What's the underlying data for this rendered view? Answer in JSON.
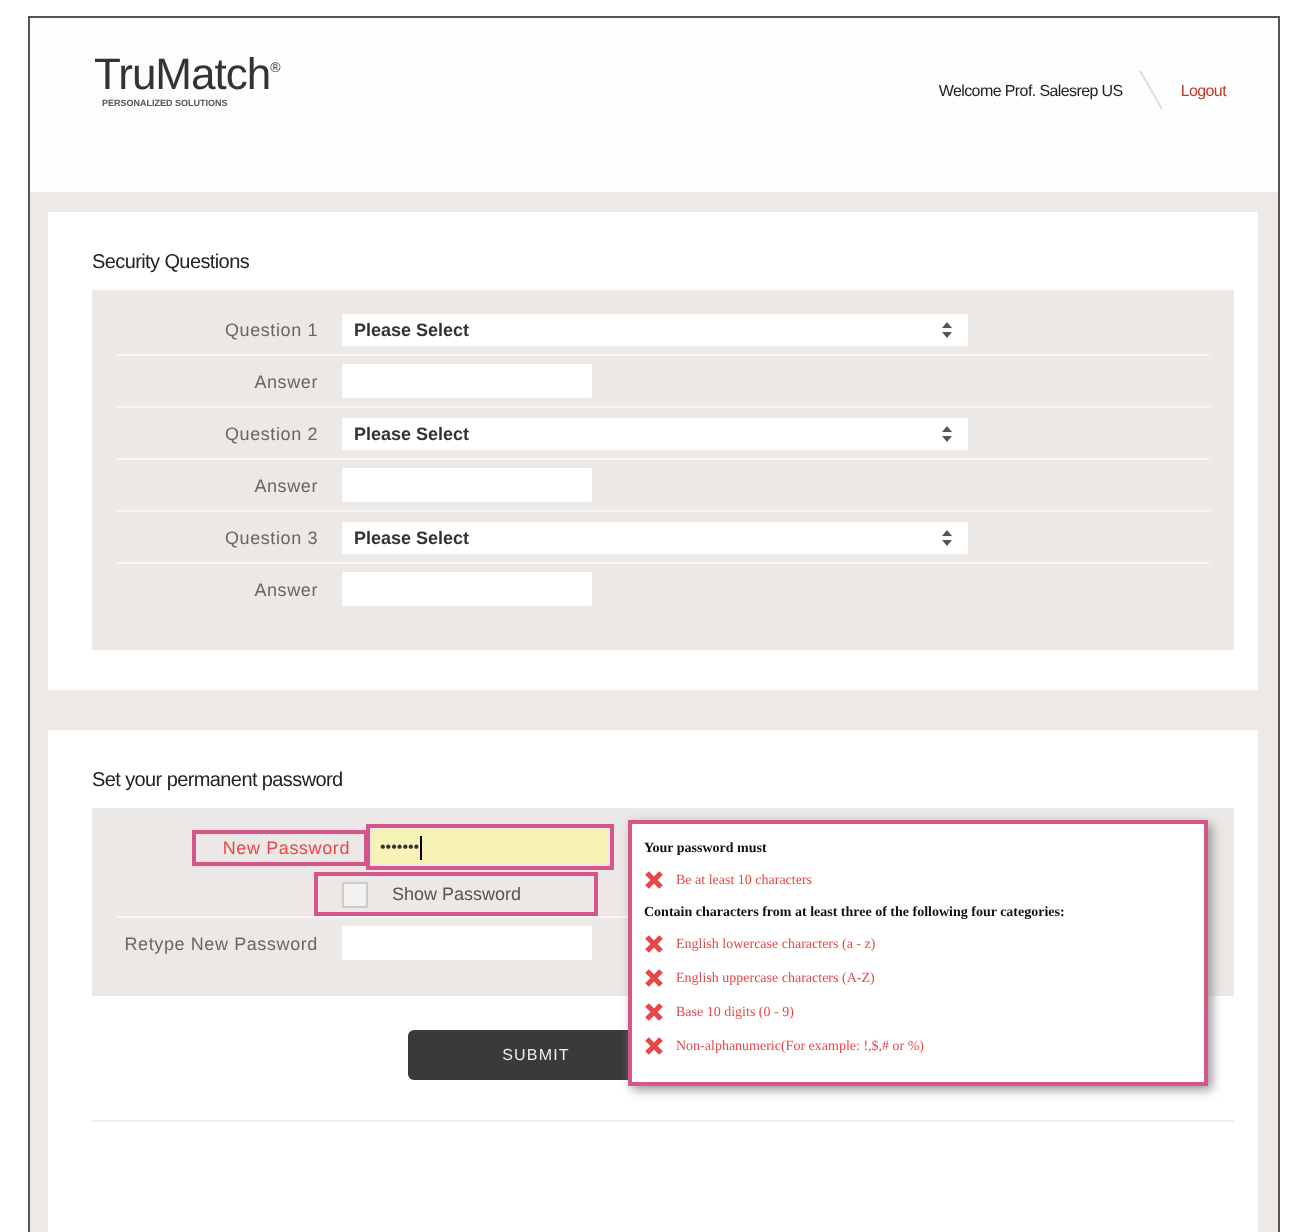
{
  "header": {
    "logo": "TruMatch",
    "logo_mark": "®",
    "tagline": "PERSONALIZED SOLUTIONS",
    "welcome": "Welcome Prof. Salesrep US",
    "logout": "Logout"
  },
  "security": {
    "title": "Security Questions",
    "rows": [
      {
        "kind": "select",
        "label": "Question 1",
        "value": "Please Select"
      },
      {
        "kind": "input",
        "label": "Answer"
      },
      {
        "kind": "select",
        "label": "Question 2",
        "value": "Please Select"
      },
      {
        "kind": "input",
        "label": "Answer"
      },
      {
        "kind": "select",
        "label": "Question 3",
        "value": "Please Select"
      },
      {
        "kind": "input",
        "label": "Answer"
      }
    ]
  },
  "password": {
    "title": "Set your permanent password",
    "new_password": {
      "label": "New Password",
      "value": "•••••••",
      "invalid": true
    },
    "show_password": {
      "label": "Show Password",
      "checked": false,
      "invalid": true
    },
    "retype": {
      "label": "Retype New Password"
    },
    "submit": "SUBMIT",
    "rules": {
      "heading": "Your password must",
      "items": [
        {
          "text": "Be at least 10 characters",
          "met": false
        }
      ],
      "subheading": "Contain characters from at least three of the following four categories:",
      "categories": [
        {
          "text": "English lowercase characters (a - z)",
          "met": false
        },
        {
          "text": "English uppercase characters (A-Z)",
          "met": false
        },
        {
          "text": "Base 10 digits (0 - 9)",
          "met": false
        },
        {
          "text": "Non-alphanumeric(For example: !,$,# or %)",
          "met": false
        }
      ]
    }
  }
}
